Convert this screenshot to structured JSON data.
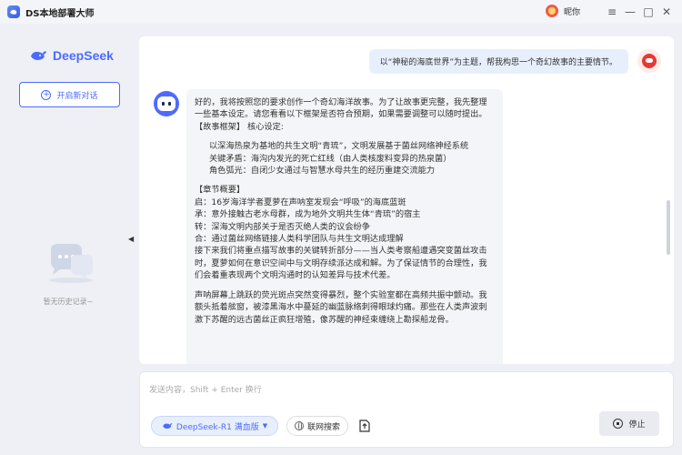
{
  "app": {
    "title": "DS本地部署大师"
  },
  "user": {
    "name": "昵你"
  },
  "window_controls": {
    "menu": "≡",
    "minimize": "—",
    "maximize": "□",
    "close": "✕"
  },
  "sidebar": {
    "brand": "DeepSeek",
    "new_chat_label": "开启新对话",
    "empty_history": "暂无历史记录~"
  },
  "chat": {
    "user_message": "以“神秘的海底世界”为主题，帮我构思一个奇幻故事的主要情节。",
    "bot_message": {
      "intro": "好的，我将按照您的要求创作一个奇幻海洋故事。为了让故事更完整，我先整理一些基本设定。请您看看以下框架是否符合预期，如果需要调整可以随时提出。",
      "framework_title": "【故事框架】 核心设定:",
      "framework_items": [
        "以深海热泉为基地的共生文明“青琉”，文明发展基于菌丝网络神经系统",
        "关键矛盾：海沟内发光的死亡红线（由人类核废料变异的热泉菌）",
        "角色弧光：自闭少女通过与智慧水母共生的经历重建交流能力"
      ],
      "chapters_title": "【章节概要】",
      "chapters": [
        "启：16岁海洋学者夏萝在声呐室发现会“呼吸”的海底蓝斑",
        "承：意外接触古老水母群，成为地外文明共生体“青琉”的宿主",
        "转：深海文明内部关于是否灭绝人类的议会纷争",
        "合：通过菌丝网络链接人类科学团队与共生文明达成理解"
      ],
      "outro": "接下来我们将重点描写故事的关键转折部分——当人类考察船遭遇突变菌丝攻击时，夏萝如何在意识空间中与文明存续派达成和解。为了保证情节的合理性，我们会着重表现两个文明沟通时的认知差异与技术代差。",
      "story": "声呐屏幕上跳跃的荧光斑点突然变得暴烈，整个实验室都在高频共振中颤动。我额头抵着舷窗，被漆黑海水中蔓延的幽蓝脉络刺得眼球灼痛。那些在人类声波刺激下苏醒的远古菌丝正疯狂增殖，像苏醒的神经束缠绕上勘探船龙骨。"
    }
  },
  "composer": {
    "placeholder": "发送内容，Shift + Enter 换行",
    "model_label": "DeepSeek-R1 满血版",
    "web_search_label": "联网搜索",
    "stop_label": "停止"
  }
}
